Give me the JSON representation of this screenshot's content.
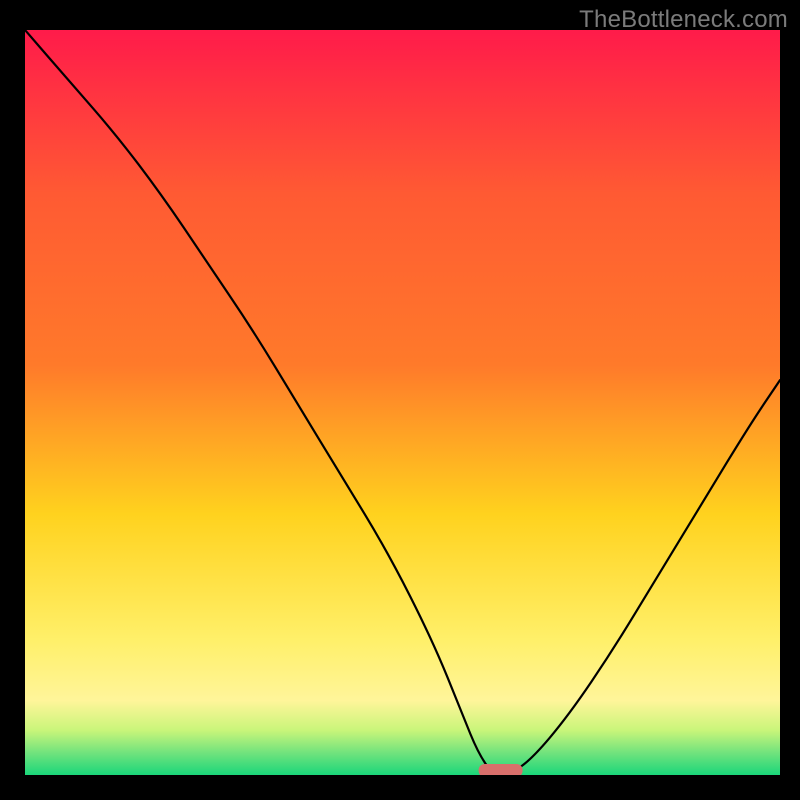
{
  "watermark": "TheBottleneck.com",
  "chart_data": {
    "type": "line",
    "title": "",
    "xlabel": "",
    "ylabel": "",
    "xlim": [
      0,
      100
    ],
    "ylim": [
      0,
      100
    ],
    "grid": false,
    "legend": false,
    "background_gradient": {
      "top": "#ff1b4a",
      "upper_mid": "#ff7a2a",
      "mid": "#ffd21e",
      "lower_mid": "#fff59a",
      "near_bottom_1": "#c9f57a",
      "near_bottom_2": "#72e37d",
      "bottom": "#1ad67a"
    },
    "series": [
      {
        "name": "bottleneck-curve",
        "x": [
          0,
          6,
          12,
          18,
          24,
          30,
          36,
          42,
          48,
          54,
          58,
          60,
          62,
          64,
          67,
          72,
          78,
          84,
          90,
          96,
          100
        ],
        "y": [
          100,
          93,
          86,
          78,
          69,
          60,
          50,
          40,
          30,
          18,
          8,
          3,
          0,
          0,
          2,
          8,
          17,
          27,
          37,
          47,
          53
        ]
      }
    ],
    "marker": {
      "name": "optimal-point",
      "x": 63,
      "y": 0,
      "shape": "rounded-bar",
      "color": "#d86f6b"
    }
  }
}
